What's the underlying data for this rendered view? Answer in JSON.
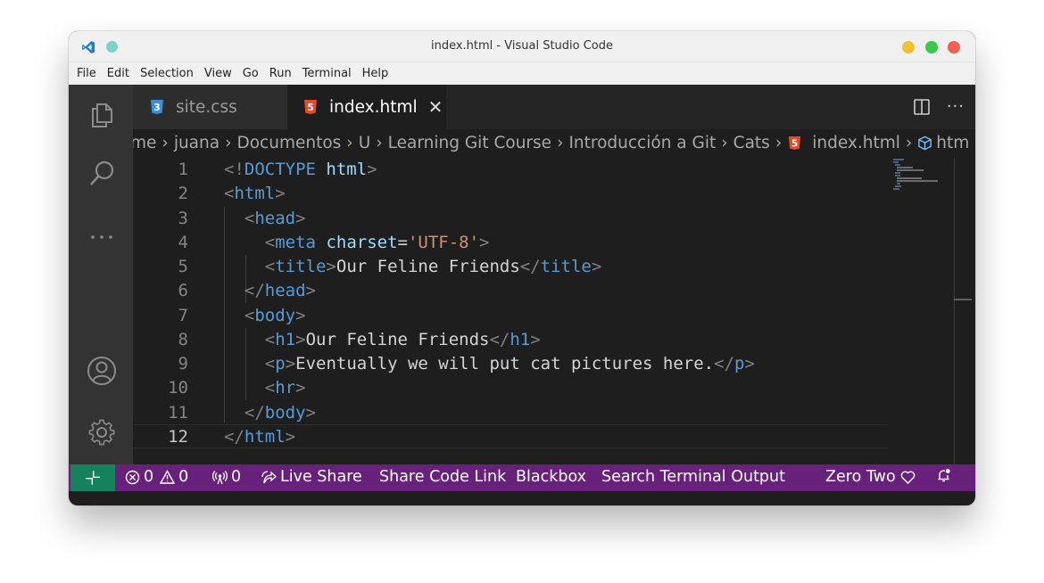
{
  "window": {
    "title": "index.html - Visual Studio Code",
    "app_icon": "vscode-logo-icon"
  },
  "menu": [
    "File",
    "Edit",
    "Selection",
    "View",
    "Go",
    "Run",
    "Terminal",
    "Help"
  ],
  "tabs": [
    {
      "label": "site.css",
      "icon": "css-file-icon",
      "active": false
    },
    {
      "label": "index.html",
      "icon": "html-file-icon",
      "active": true,
      "close_glyph": "✕"
    }
  ],
  "breadcrumb": [
    "me",
    "juana",
    "Documentos",
    "U",
    "Learning Git Course",
    "Introducción a Git",
    "Cats",
    "index.html",
    "htm"
  ],
  "editor": {
    "line_numbers": [
      "1",
      "2",
      "3",
      "4",
      "5",
      "6",
      "7",
      "8",
      "9",
      "10",
      "11",
      "12"
    ],
    "current_line": "12",
    "code": {
      "doctype_open": "<!",
      "doctype_kw": "DOCTYPE",
      "doctype_html": "html",
      "lt": "<",
      "gt": ">",
      "close_lt": "</",
      "html_tag": "html",
      "head_tag": "head",
      "meta_tag": "meta",
      "charset_attr": "charset",
      "eq": "=",
      "charset_val": "'UTF-8'",
      "title_tag": "title",
      "title_text": "Our Feline Friends",
      "body_tag": "body",
      "h1_tag": "h1",
      "h1_text": "Our Feline Friends",
      "p_tag": "p",
      "p_text": "Eventually we will put cat pictures here.",
      "hr_tag": "hr"
    }
  },
  "statusbar": {
    "errors": "0",
    "warnings": "0",
    "ports": "0",
    "live_share": "Live Share",
    "share_code_link": "Share Code Link",
    "blackbox": "Blackbox",
    "search_terminal": "Search Terminal Output",
    "account": "Zero Two"
  },
  "colors": {
    "statusbar_bg": "#68217a",
    "remote_bg": "#16825d",
    "editor_bg": "#1e1e1e",
    "tag_blue": "#569cd6",
    "attr_light_blue": "#9cdcfe",
    "string_orange": "#ce9178"
  }
}
